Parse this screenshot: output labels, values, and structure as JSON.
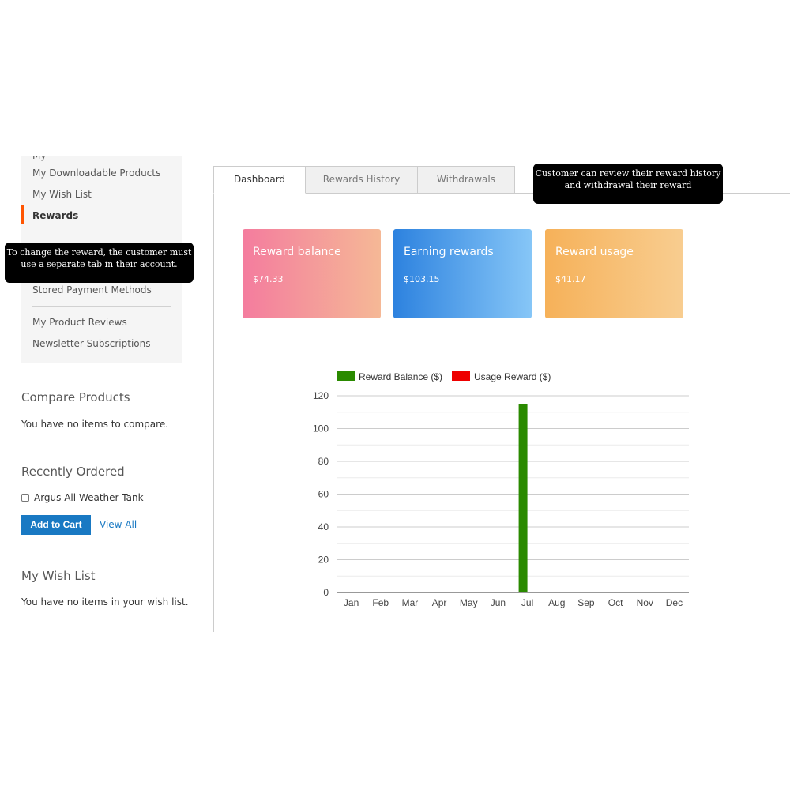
{
  "sidebar": {
    "nav": {
      "items": [
        {
          "label": "My Downloadable Products"
        },
        {
          "label": "My Wish List"
        },
        {
          "label": "Rewards"
        },
        {
          "label": "Stored Payment Methods"
        },
        {
          "label": "My Product Reviews"
        },
        {
          "label": "Newsletter Subscriptions"
        }
      ],
      "active_index": 2,
      "active_color": "#ff5501"
    },
    "compare": {
      "title": "Compare Products",
      "empty_text": "You have no items to compare."
    },
    "recently_ordered": {
      "title": "Recently Ordered",
      "item": "Argus All-Weather Tank",
      "add_to_cart": "Add to Cart",
      "view_all": "View All"
    },
    "wishlist": {
      "title": "My Wish List",
      "empty_text": "You have no items in your wish list."
    }
  },
  "tabs": [
    {
      "label": "Dashboard",
      "active": true
    },
    {
      "label": "Rewards History",
      "active": false
    },
    {
      "label": "Withdrawals",
      "active": false
    }
  ],
  "callouts": {
    "left": {
      "line1": "To change the reward, the customer must",
      "line2": "use a separate tab in their account."
    },
    "right": {
      "line1": "Customer can review their reward history",
      "line2": "and withdrawal their reward"
    }
  },
  "cards": [
    {
      "title": "Reward balance",
      "value": "$74.33",
      "colors": [
        "#f47c9e",
        "#f5b896"
      ]
    },
    {
      "title": "Earning rewards",
      "value": "$103.15",
      "colors": [
        "#2d82df",
        "#86c6f7"
      ]
    },
    {
      "title": "Reward usage",
      "value": "$41.17",
      "colors": [
        "#f6b159",
        "#f8cd90"
      ]
    }
  ],
  "colors": {
    "link": "#1979c3",
    "button": "#1979c3"
  },
  "chart_data": {
    "type": "bar",
    "categories": [
      "Jan",
      "Feb",
      "Mar",
      "Apr",
      "May",
      "Jun",
      "Jul",
      "Aug",
      "Sep",
      "Oct",
      "Nov",
      "Dec"
    ],
    "series": [
      {
        "name": "Reward Balance ($)",
        "color": "#2a8a00",
        "values": [
          0,
          0,
          0,
          0,
          0,
          0,
          115,
          0,
          0,
          0,
          0,
          0
        ]
      },
      {
        "name": "Usage Reward ($)",
        "color": "#ee0000",
        "values": [
          0,
          0,
          0,
          0,
          0,
          0,
          0,
          0,
          0,
          0,
          0,
          0
        ]
      }
    ],
    "yticks": [
      0,
      20,
      40,
      60,
      80,
      100,
      120
    ],
    "ylim": [
      0,
      120
    ],
    "grid": true,
    "legend": "top"
  }
}
